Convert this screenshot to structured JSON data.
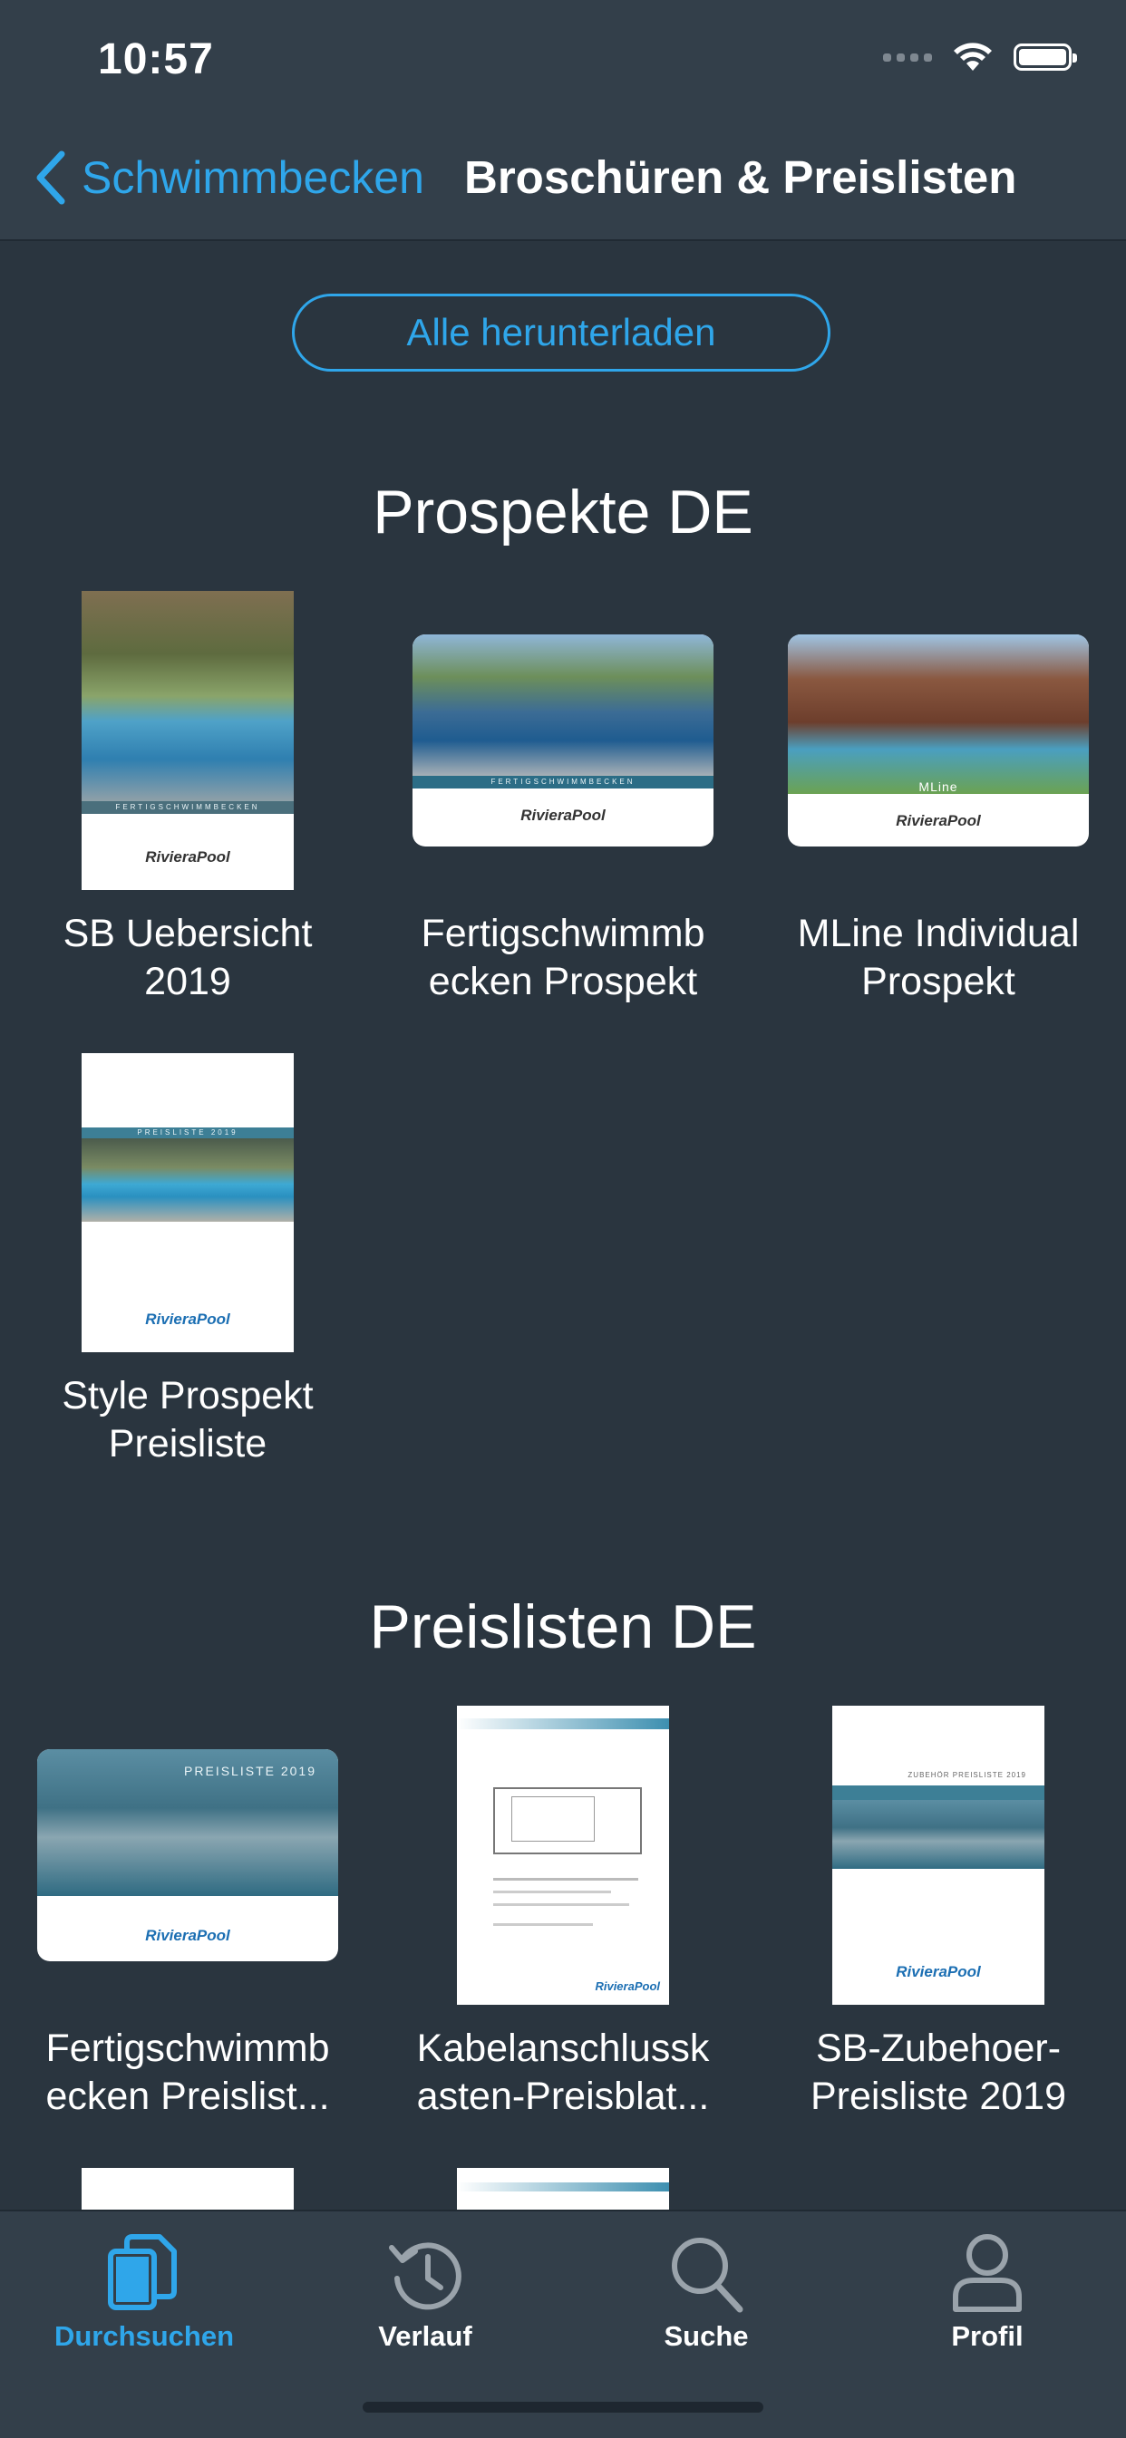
{
  "status_bar": {
    "time": "10:57"
  },
  "nav": {
    "back_label": "Schwimmbecken",
    "title": "Broschüren & Preislisten"
  },
  "actions": {
    "download_all": "Alle herunterladen"
  },
  "sections": [
    {
      "title": "Prospekte DE",
      "items": [
        {
          "label": "SB Uebersicht 2019",
          "cover_brand": "RivieraPool",
          "cover_text": "FERTIGSCHWIMMBECKEN"
        },
        {
          "label": "Fertigschwimmb ecken Prospekt",
          "cover_brand": "RivieraPool",
          "cover_text": "FERTIGSCHWIMMBECKEN"
        },
        {
          "label": "MLine Individual Prospekt",
          "cover_brand": "RivieraPool",
          "cover_text": "MLine"
        },
        {
          "label": "Style Prospekt Preisliste",
          "cover_brand": "RivieraPool",
          "cover_text": "PREISLISTE 2019"
        }
      ]
    },
    {
      "title": "Preislisten DE",
      "items": [
        {
          "label": "Fertigschwimmb ecken Preislist...",
          "cover_brand": "RivieraPool",
          "cover_text": "PREISLISTE 2019"
        },
        {
          "label": "Kabelanschlussk asten-Preisblat...",
          "cover_brand": "RivieraPool",
          "cover_text": ""
        },
        {
          "label": "SB-Zubehoer-Preisliste 2019",
          "cover_brand": "RivieraPool",
          "cover_text": "ZUBEHÖR PREISLISTE 2019"
        }
      ]
    }
  ],
  "tabs": [
    {
      "label": "Durchsuchen",
      "icon": "documents-icon",
      "active": true
    },
    {
      "label": "Verlauf",
      "icon": "history-icon",
      "active": false
    },
    {
      "label": "Suche",
      "icon": "search-icon",
      "active": false
    },
    {
      "label": "Profil",
      "icon": "profile-icon",
      "active": false
    }
  ],
  "colors": {
    "background": "#2a353f",
    "bar": "#333f4a",
    "accent": "#2fa6ea"
  }
}
